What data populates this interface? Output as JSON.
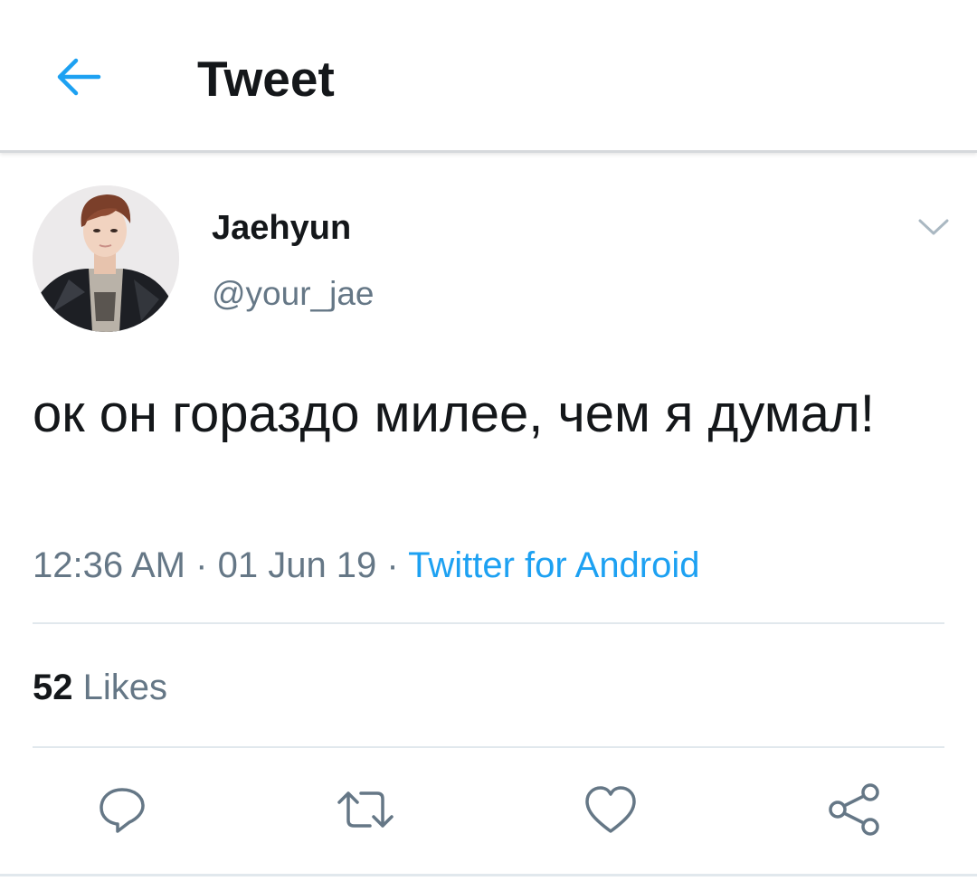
{
  "colors": {
    "accent": "#1da1f2",
    "text_primary": "#14171a",
    "text_secondary": "#657786",
    "icon_gray": "#657786",
    "divider": "#e1e8ed"
  },
  "header": {
    "back_icon": "arrow-left-icon",
    "title": "Tweet"
  },
  "author": {
    "display_name": "Jaehyun",
    "handle": "@your_jae",
    "avatar": "profile-photo",
    "menu_icon": "chevron-down-icon"
  },
  "tweet": {
    "text": "ок он гораздо милее, чем я думал!",
    "time": "12:36 AM",
    "date": "01 Jun 19",
    "separator": "·",
    "source": "Twitter for Android"
  },
  "stats": {
    "likes_count": "52",
    "likes_label": "Likes"
  },
  "actions": [
    {
      "icon": "reply-icon"
    },
    {
      "icon": "retweet-icon"
    },
    {
      "icon": "heart-icon"
    },
    {
      "icon": "share-icon"
    }
  ]
}
